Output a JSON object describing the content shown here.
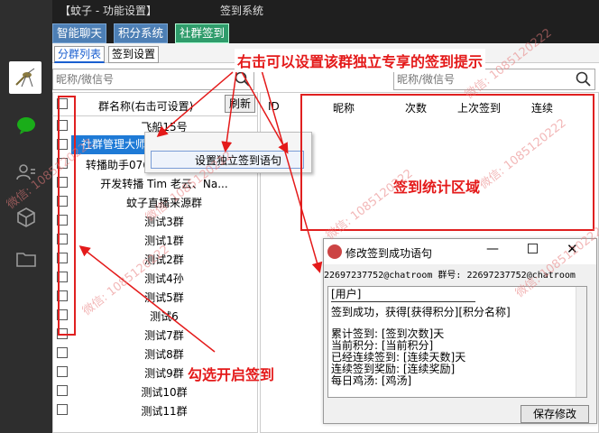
{
  "window": {
    "title": "【蚊子 - 功能设置】",
    "subtitle": "签到系统"
  },
  "main_tabs": [
    {
      "label": "智能聊天"
    },
    {
      "label": "积分系统"
    },
    {
      "label": "社群签到"
    }
  ],
  "sub_tabs": [
    {
      "label": "分群列表"
    },
    {
      "label": "签到设置"
    }
  ],
  "group_search": {
    "placeholder": "昵称/微信号"
  },
  "stats_search": {
    "placeholder": "昵称/微信号"
  },
  "group_list": {
    "column": "群名称(右击可设置)",
    "refresh_label": "刷新",
    "rows": [
      "飞船15号",
      "社群管理大师测试群",
      "转播助手076",
      "开发转播 Tim 老云、Na...",
      "蚊子直播来源群",
      "测试3群",
      "测试1群",
      "测试2群",
      "测试4孙",
      "测试5群",
      "测试6",
      "测试7群",
      "测试8群",
      "测试9群",
      "测试10群",
      "测试11群"
    ]
  },
  "context_menu": {
    "item": "设置独立签到语句"
  },
  "stats_table": {
    "columns": [
      "ID",
      "昵称",
      "次数",
      "上次签到",
      "连续"
    ]
  },
  "dialog": {
    "title": "修改签到成功语句",
    "ids": "22697237752@chatroom 群号: 22697237752@chatroom",
    "lines": [
      "[用户]",
      "签到成功，获得[获得积分][积分名称]",
      "累计签到: [签到次数]天",
      "当前积分: [当前积分]",
      "已经连续签到: [连续天数]天",
      "连续签到奖励: [连续奖励]",
      "每日鸡汤: [鸡汤]"
    ],
    "save_label": "保存修改"
  },
  "annotations": {
    "right_click": "右击可以设置该群独立专享的签到提示",
    "stats_area": "签到统计区域",
    "check_enable": "勾选开启签到"
  },
  "watermark": "微信: 1085120222",
  "colors": {
    "accent_red": "#e41a1a",
    "selected_blue": "#1e7ad6",
    "active_tab": "#2f9c6b",
    "tab_blue": "#4d7fb5"
  }
}
